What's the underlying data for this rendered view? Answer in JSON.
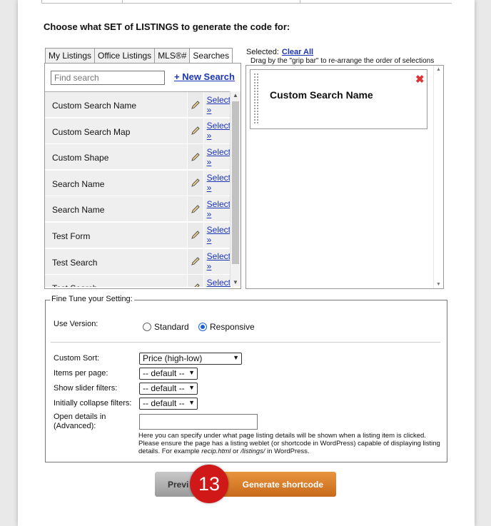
{
  "heading": "Choose what SET of LISTINGS to generate the code for:",
  "tabs": [
    "My Listings",
    "Office Listings",
    "MLS®#",
    "Searches"
  ],
  "search": {
    "placeholder": "Find search"
  },
  "new_search": "+ New Search",
  "rows": [
    {
      "name": "Custom Search Name",
      "select": "Select »"
    },
    {
      "name": "Custom Search Map",
      "select": "Select »"
    },
    {
      "name": "Custom Shape",
      "select": "Select »"
    },
    {
      "name": "Search Name",
      "select": "Select »"
    },
    {
      "name": "Search Name",
      "select": "Select »"
    },
    {
      "name": "Test Form",
      "select": "Select »"
    },
    {
      "name": "Test Search",
      "select": "Select »"
    },
    {
      "name": "Test Search",
      "select": "Select »"
    }
  ],
  "selected": {
    "label": "Selected:",
    "clear": "Clear All",
    "hint": "Drag by the \"grip bar\" to re-arrange the order of selections",
    "item": "Custom Search Name"
  },
  "fine_tune": {
    "legend": "Fine Tune your Setting:",
    "use_version": "Use Version:",
    "standard": "Standard",
    "responsive": "Responsive",
    "custom_sort": "Custom Sort:",
    "custom_sort_value": "Price (high-low)",
    "items_per_page": "Items per page:",
    "show_slider": "Show slider filters:",
    "collapse_filters": "Initially collapse filters:",
    "default_value": "-- default --",
    "open_details_1": "Open details in",
    "open_details_2": "(Advanced):",
    "help_1": "Here you can specify under what page listing details will be shown when a listing item is clicked. Please ensure the page has a listing weblet (or shortcode in WordPress) capable of displaying listing details. For example ",
    "help_ex1": "recip.html",
    "help_or": " or ",
    "help_ex2": "/listings/",
    "help_end": " in WordPress."
  },
  "buttons": {
    "preview": "Previ",
    "generate": "Generate shortcode"
  },
  "badge": "13"
}
